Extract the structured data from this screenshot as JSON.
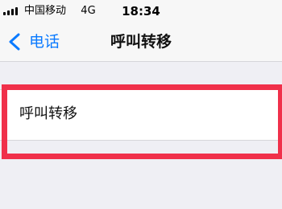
{
  "status_bar": {
    "carrier": "中国移动",
    "network": "4G",
    "time": "18:34"
  },
  "nav": {
    "back_label": "电话",
    "title": "呼叫转移"
  },
  "settings": {
    "call_forwarding_label": "呼叫转移"
  },
  "colors": {
    "accent": "#0a7aff",
    "highlight": "#f0304a",
    "background": "#efeff4"
  }
}
